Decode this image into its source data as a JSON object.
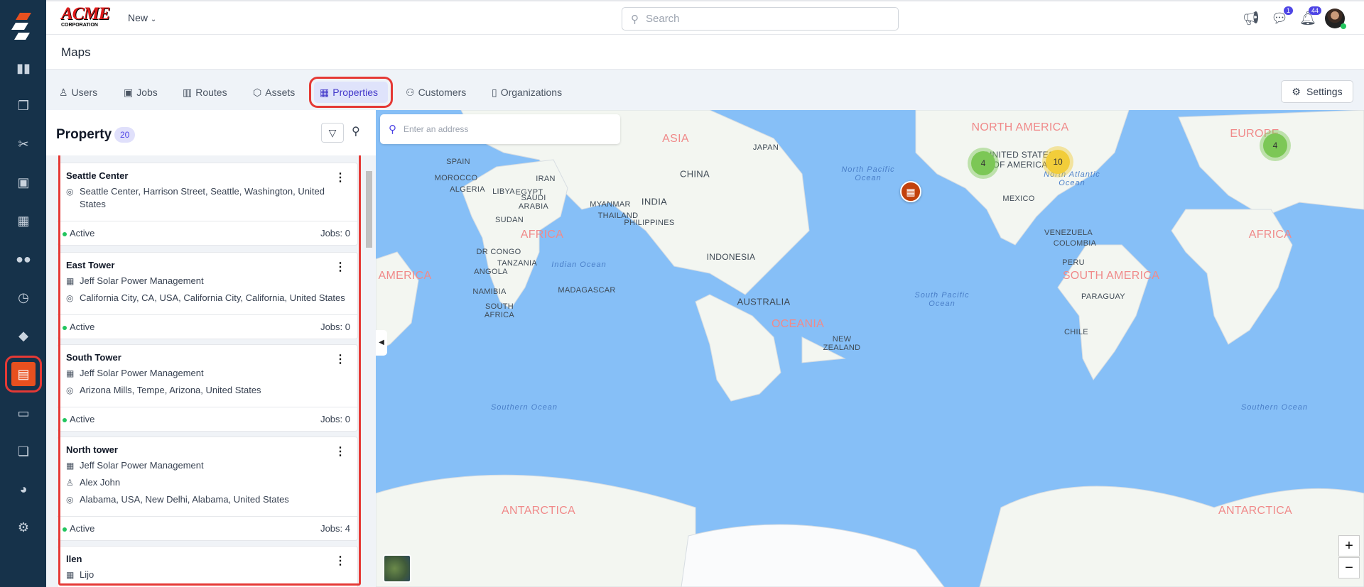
{
  "app": {
    "logo_text": "ACME",
    "logo_sub": "CORPORATION",
    "new_label": "New",
    "search_placeholder": "Search",
    "chat_badge": "1",
    "notif_badge": "44"
  },
  "sidebar": {
    "items": [
      "reports",
      "work-orders",
      "tools",
      "jobs",
      "calendar",
      "users",
      "timesheets",
      "tags",
      "maps",
      "invoices",
      "documents",
      "analytics",
      "settings"
    ],
    "active": "maps"
  },
  "page": {
    "title": "Maps"
  },
  "tabs": [
    {
      "label": "Users"
    },
    {
      "label": "Jobs"
    },
    {
      "label": "Routes"
    },
    {
      "label": "Assets"
    },
    {
      "label": "Properties",
      "active": true
    },
    {
      "label": "Customers"
    },
    {
      "label": "Organizations"
    }
  ],
  "settings_label": "Settings",
  "panel": {
    "title": "Property",
    "count": "20",
    "cards": [
      {
        "name": "Seattle Center",
        "address": "Seattle Center, Harrison Street, Seattle, Washington, United States",
        "status": "Active",
        "jobs": "Jobs: 0"
      },
      {
        "name": "East Tower",
        "org": "Jeff Solar Power Management",
        "address": "California City, CA, USA, California City, California, United States",
        "status": "Active",
        "jobs": "Jobs: 0"
      },
      {
        "name": "South Tower",
        "org": "Jeff Solar Power Management",
        "address": "Arizona Mills, Tempe, Arizona, United States",
        "status": "Active",
        "jobs": "Jobs: 0"
      },
      {
        "name": "North tower",
        "org": "Jeff Solar Power Management",
        "contact": "Alex John",
        "address": "Alabama, USA, New Delhi, Alabama, United States",
        "status": "Active",
        "jobs": "Jobs: 4"
      },
      {
        "name": "llen",
        "org": "Lijo"
      }
    ]
  },
  "map": {
    "address_placeholder": "Enter an address",
    "clusters": [
      "4",
      "10",
      "4"
    ],
    "continents": [
      "ASIA",
      "NORTH AMERICA",
      "EUROPE",
      "AFRICA",
      "AFRICA",
      "AMERICA",
      "SOUTH AMERICA",
      "OCEANIA",
      "ANTARCTICA",
      "ANTARCTICA"
    ],
    "countries": [
      "CHINA",
      "INDIA",
      "AUSTRALIA",
      "INDONESIA",
      "JAPAN",
      "UNITED STATES OF AMERICA",
      "MEXICO",
      "VENEZUELA",
      "COLOMBIA",
      "PERU",
      "PARAGUAY",
      "CHILE",
      "MADAGASCAR",
      "NEW ZEALAND",
      "SPAIN",
      "MOROCCO",
      "ALGERIA",
      "LIBYA",
      "EGYPT",
      "SUDAN",
      "DR CONGO",
      "TANZANIA",
      "ANGOLA",
      "NAMIBIA",
      "SOUTH AFRICA",
      "SAUDI ARABIA",
      "IRAN",
      "PHILIPPINES",
      "THAILAND",
      "MYANMAR"
    ],
    "oceans": [
      "Indian Ocean",
      "North Pacific Ocean",
      "South Pacific Ocean",
      "North Atlantic Ocean",
      "Southern Ocean",
      "Southern Ocean"
    ],
    "zoom_in": "+",
    "zoom_out": "−"
  }
}
